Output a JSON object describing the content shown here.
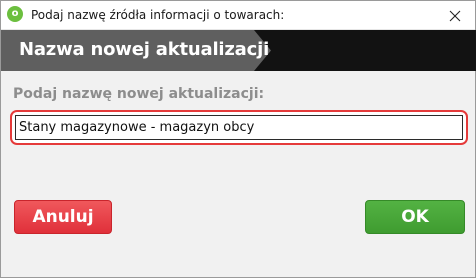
{
  "window": {
    "title": "Podaj nazwę źródła informacji o towarach:",
    "app_icon_glyph": "o"
  },
  "banner": {
    "title": "Nazwa nowej aktualizacji"
  },
  "form": {
    "label": "Podaj nazwę nowej aktualizacji:",
    "value": "Stany magazynowe - magazyn obcy"
  },
  "buttons": {
    "cancel_label": "Anuluj",
    "ok_label": "OK"
  },
  "colors": {
    "cancel": "#e0303a",
    "ok": "#46a535",
    "focus_ring": "#e53a3a",
    "banner_dark": "#121212",
    "banner_grey": "#5f5f5f"
  }
}
